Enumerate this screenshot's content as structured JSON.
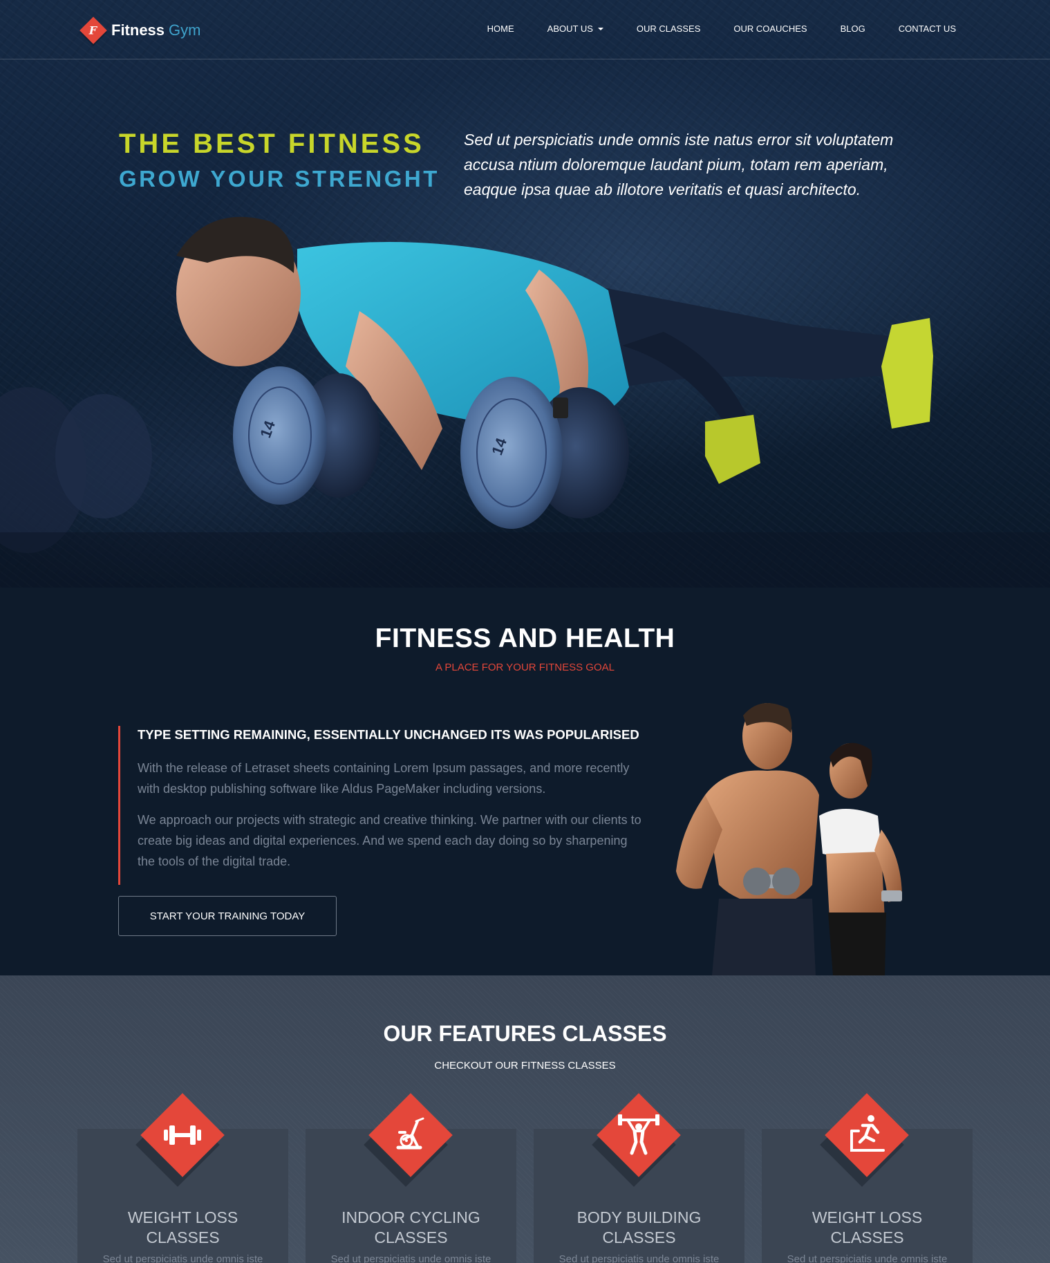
{
  "brand": {
    "name_bold": "Fitness",
    "name_light": "Gym",
    "mark": "F",
    "accent": "#e4473a"
  },
  "nav": {
    "items": [
      {
        "label": "HOME"
      },
      {
        "label": "ABOUT US"
      },
      {
        "label": "OUR CLASSES"
      },
      {
        "label": "OUR COAUCHES"
      },
      {
        "label": "BLOG"
      },
      {
        "label": "CONTACT US"
      }
    ]
  },
  "hero": {
    "title": "THE BEST FITNESS",
    "subtitle": "GROW YOUR STRENGHT",
    "text": "Sed ut perspiciatis unde omnis iste natus error sit voluptatem accusa ntium doloremque laudant pium, totam rem aperiam, eaqque ipsa quae ab illotore veritatis et quasi architecto.",
    "dumbbell_label_left": "14",
    "dumbbell_label_right": "14"
  },
  "about": {
    "title": "FITNESS AND HEALTH",
    "tagline": "A PLACE FOR YOUR FITNESS GOAL",
    "heading": "TYPE SETTING REMAINING, ESSENTIALLY UNCHANGED ITS WAS POPULARISED",
    "paragraph_1": "With the release of Letraset sheets containing Lorem Ipsum passages, and more recently with desktop publishing software like Aldus PageMaker including versions.",
    "paragraph_2": "We approach our projects with strategic and creative thinking. We partner with our clients to create big ideas and digital experiences. And we spend each day doing so by sharpening the tools of the digital trade.",
    "cta_label": "START YOUR TRAINING TODAY"
  },
  "features": {
    "title": "OUR FEATURES CLASSES",
    "tagline": "CHECKOUT OUR FITNESS CLASSES",
    "cards": [
      {
        "icon": "dumbbell-icon",
        "title_1": "WEIGHT LOSS",
        "title_2": "CLASSES",
        "text": "Sed ut perspiciatis unde omnis iste"
      },
      {
        "icon": "exercise-bike-icon",
        "title_1": "INDOOR CYCLING",
        "title_2": "CLASSES",
        "text": "Sed ut perspiciatis unde omnis iste"
      },
      {
        "icon": "weightlifter-icon",
        "title_1": "BODY BUILDING",
        "title_2": "CLASSES",
        "text": "Sed ut perspiciatis unde omnis iste"
      },
      {
        "icon": "treadmill-runner-icon",
        "title_1": "WEIGHT LOSS",
        "title_2": "CLASSES",
        "text": "Sed ut perspiciatis unde omnis iste"
      }
    ]
  },
  "colors": {
    "hero_title": "#c8d62a",
    "hero_subtitle": "#3ea8d0",
    "accent": "#e4473a"
  }
}
